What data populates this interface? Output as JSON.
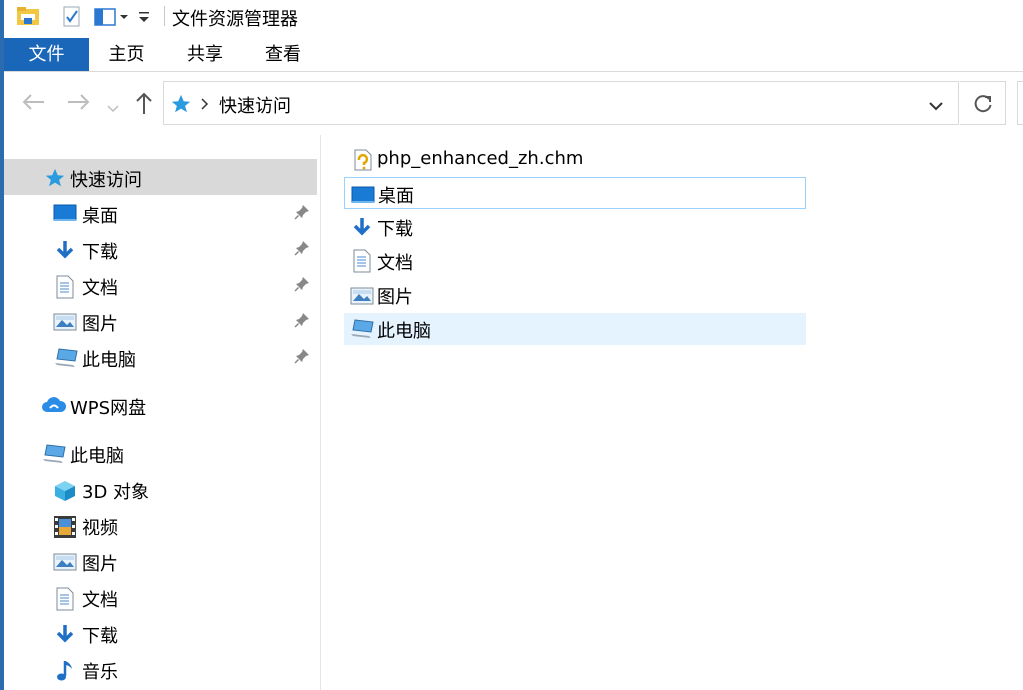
{
  "window": {
    "title": "文件资源管理器"
  },
  "ribbon": {
    "tabs": [
      {
        "label": "文件",
        "active": true
      },
      {
        "label": "主页"
      },
      {
        "label": "共享"
      },
      {
        "label": "查看"
      }
    ]
  },
  "address": {
    "path": "快速访问"
  },
  "nav_pane": {
    "quick_access": {
      "label": "快速访问",
      "items": [
        {
          "label": "桌面",
          "icon": "desktop-icon",
          "pinned": true
        },
        {
          "label": "下载",
          "icon": "download-icon",
          "pinned": true
        },
        {
          "label": "文档",
          "icon": "documents-icon",
          "pinned": true
        },
        {
          "label": "图片",
          "icon": "pictures-icon",
          "pinned": true
        },
        {
          "label": "此电脑",
          "icon": "this-pc-icon",
          "pinned": true
        }
      ]
    },
    "wps": {
      "label": "WPS网盘"
    },
    "this_pc": {
      "label": "此电脑",
      "items": [
        {
          "label": "3D 对象",
          "icon": "3d-objects-icon"
        },
        {
          "label": "视频",
          "icon": "videos-icon"
        },
        {
          "label": "图片",
          "icon": "pictures-icon"
        },
        {
          "label": "文档",
          "icon": "documents-icon"
        },
        {
          "label": "下载",
          "icon": "download-icon"
        },
        {
          "label": "音乐",
          "icon": "music-icon"
        }
      ]
    }
  },
  "content": {
    "items": [
      {
        "label": "php_enhanced_zh.chm",
        "icon": "help-file-icon"
      },
      {
        "label": "桌面",
        "icon": "desktop-icon",
        "state": "focused"
      },
      {
        "label": "下载",
        "icon": "download-icon"
      },
      {
        "label": "文档",
        "icon": "documents-icon"
      },
      {
        "label": "图片",
        "icon": "pictures-icon"
      },
      {
        "label": "此电脑",
        "icon": "this-pc-icon",
        "state": "hover"
      }
    ]
  },
  "colors": {
    "accent": "#1a66b8",
    "selected_bg": "#d9d9d9",
    "hover_bg": "#e5f3ff",
    "focus_border": "#99d1ff"
  }
}
